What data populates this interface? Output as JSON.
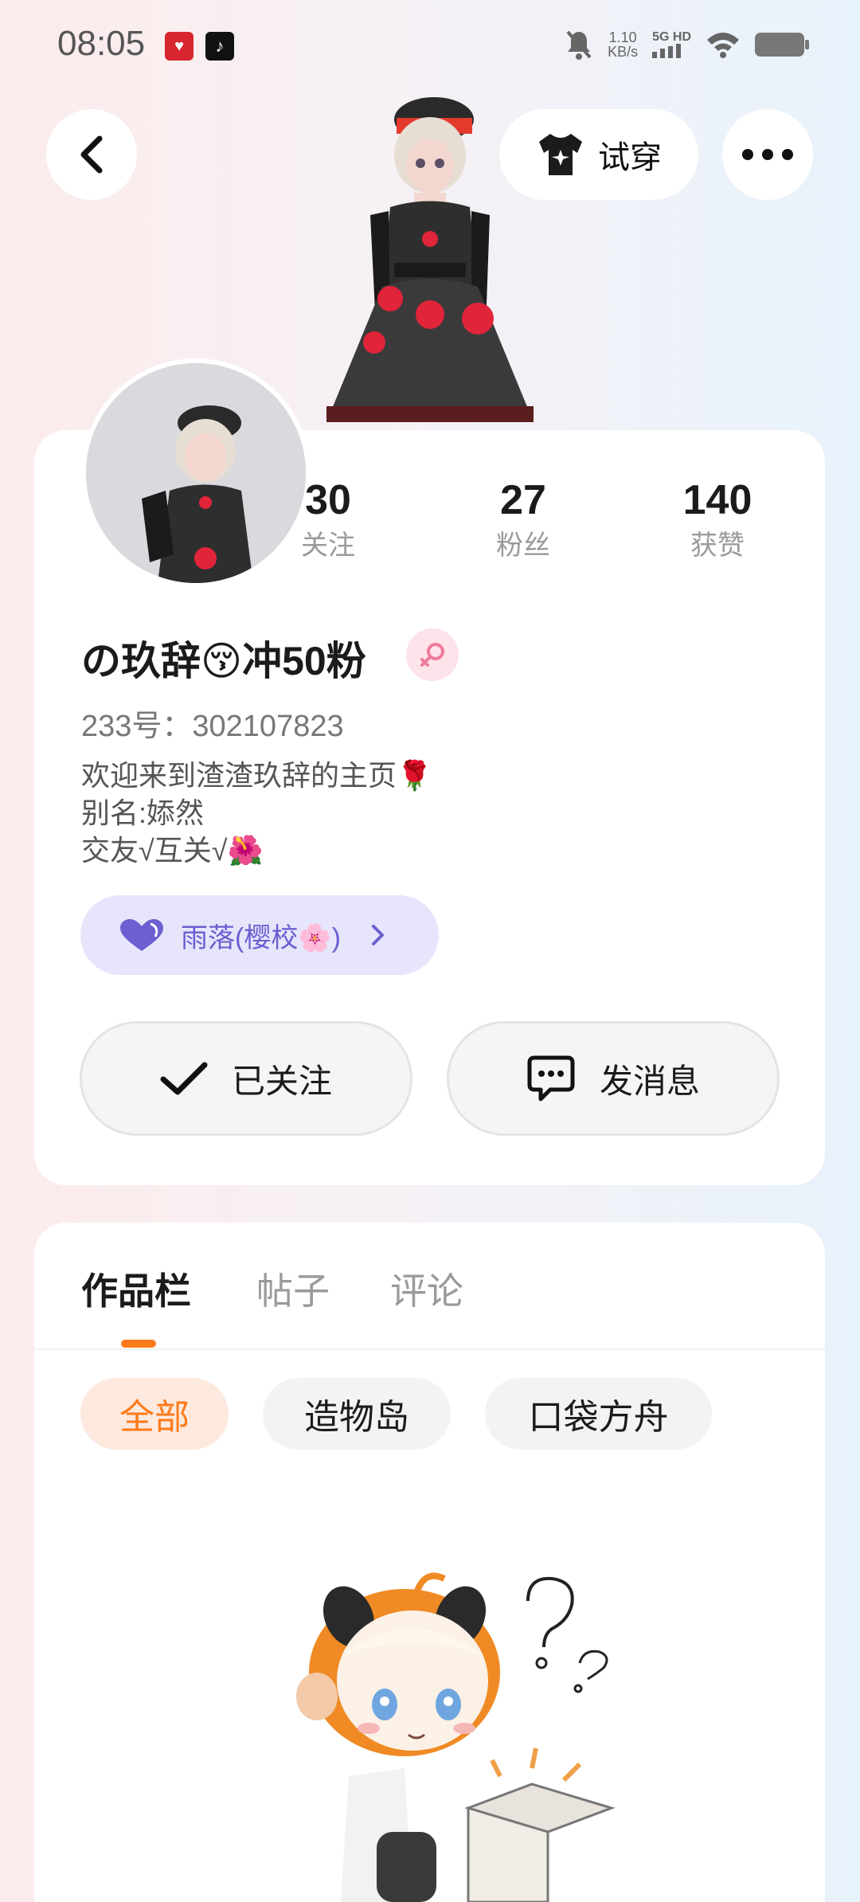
{
  "status_bar": {
    "time": "08:05",
    "app_icon_1": "app-icon",
    "app_icon_2": "tiktok-icon",
    "net_speed_value": "1.10",
    "net_speed_unit": "KB/s",
    "signal_label": "5G HD"
  },
  "header": {
    "back_icon": "chevron-left-icon",
    "try_on_label": "试穿",
    "try_on_icon": "shirt-icon",
    "more_icon": "more-dots-icon"
  },
  "profile": {
    "stats": [
      {
        "value": "30",
        "label": "关注"
      },
      {
        "value": "27",
        "label": "粉丝"
      },
      {
        "value": "140",
        "label": "获赞"
      }
    ],
    "nickname": "の玖辞😚冲50粉",
    "gender": "female",
    "uid": "233号：302107823",
    "bio": [
      "欢迎来到渣渣玖辞的主页🌹",
      "别名:婖然",
      "交友√互关√🌺"
    ],
    "group_label": "雨落(樱校🌸)",
    "follow_button": "已关注",
    "message_button": "发消息"
  },
  "works": {
    "tabs": [
      {
        "label": "作品栏",
        "active": true
      },
      {
        "label": "帖子",
        "active": false
      },
      {
        "label": "评论",
        "active": false
      }
    ],
    "filters": [
      {
        "label": "全部",
        "active": true
      },
      {
        "label": "造物岛",
        "active": false
      },
      {
        "label": "口袋方舟",
        "active": false
      }
    ]
  },
  "colors": {
    "accent": "#ff7a1a",
    "group_pill_bg": "#e7e5fb",
    "group_pill_text": "#6b5fd1"
  }
}
